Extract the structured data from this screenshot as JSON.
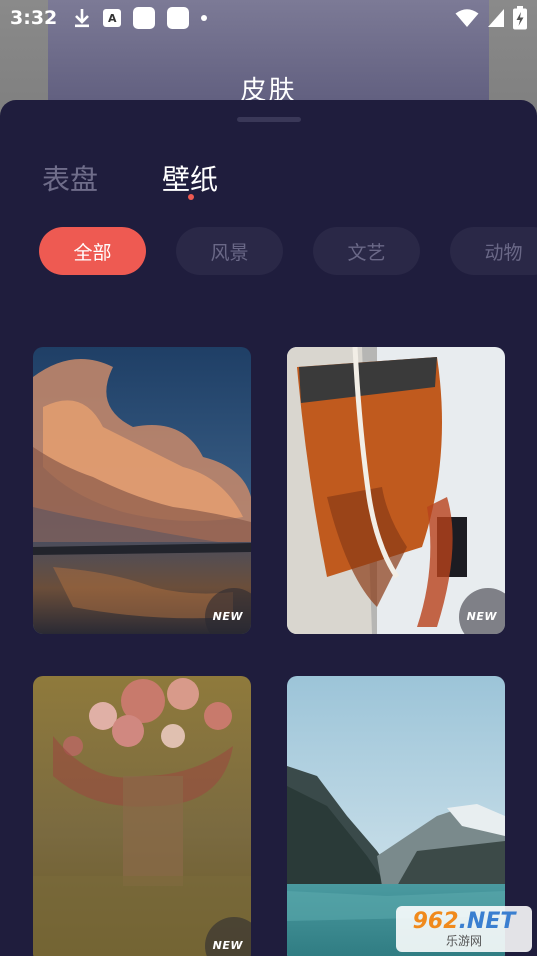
{
  "status_bar": {
    "time": "3:32",
    "icons": [
      "download-icon",
      "a-app-icon",
      "square-app-icon",
      "square-app-icon",
      "dot-icon",
      "wifi-icon",
      "signal-icon",
      "battery-charging-icon"
    ]
  },
  "background_page": {
    "title": "皮肤"
  },
  "tabs": [
    {
      "label": "表盘",
      "active": false
    },
    {
      "label": "壁纸",
      "active": true
    }
  ],
  "categories": [
    {
      "label": "全部",
      "active": true
    },
    {
      "label": "风景",
      "active": false
    },
    {
      "label": "文艺",
      "active": false
    },
    {
      "label": "动物",
      "active": false
    }
  ],
  "wallpapers": [
    {
      "subject": "sunset-clouds-over-beach",
      "badge": "NEW"
    },
    {
      "subject": "life-buoy-with-rope",
      "badge": "NEW"
    },
    {
      "subject": "flower-bouquet",
      "badge": "NEW"
    },
    {
      "subject": "mountain-lake",
      "badge": ""
    }
  ],
  "watermark": {
    "brand_number": "962",
    "brand_net": ".NET",
    "brand_text": "乐游网"
  },
  "colors": {
    "sheet_bg": "#1f1d3d",
    "chip_bg": "#2a2847",
    "accent": "#ee5a52",
    "inactive_text": "#6f6d8a"
  }
}
